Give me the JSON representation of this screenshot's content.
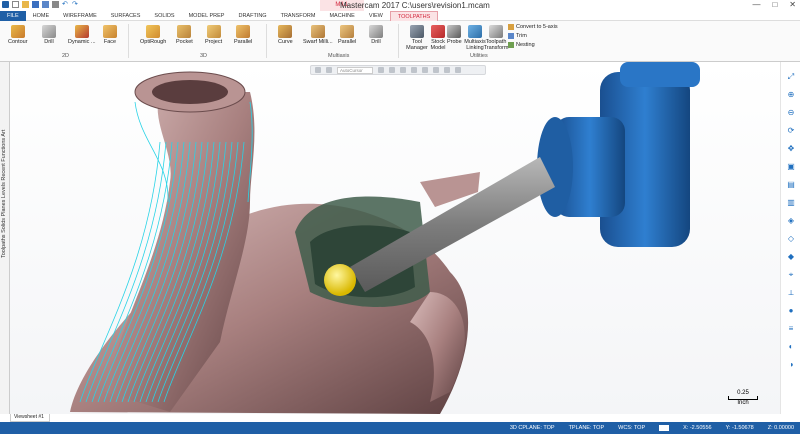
{
  "app": {
    "title": "Mastercam 2017  C:\\users\\revision1.mcam",
    "context_tab": "MILL",
    "window_controls": [
      "—",
      "□",
      "✕"
    ]
  },
  "tabs": [
    "FILE",
    "HOME",
    "WIREFRAME",
    "SURFACES",
    "SOLIDS",
    "MODEL PREP",
    "DRAFTING",
    "TRANSFORM",
    "MACHINE",
    "VIEW",
    "TOOLPATHS"
  ],
  "ribbon": {
    "group_2d": {
      "label": "2D",
      "buttons": [
        "Contour",
        "Drill",
        "Dynamic ...",
        "Face"
      ]
    },
    "group_3d": {
      "label": "3D",
      "buttons": [
        "OptiRough",
        "Pocket",
        "Project",
        "Parallel"
      ]
    },
    "group_multiaxis": {
      "label": "Multiaxis",
      "buttons": [
        "Curve",
        "Swarf Milli...",
        "Parallel",
        "Drill"
      ]
    },
    "group_utilities": {
      "label": "Utilities",
      "buttons": [
        "Tool Manager",
        "Stock Model",
        "Probe",
        "Multiaxis Linking",
        "Toolpath Transform"
      ],
      "small_items": [
        "Convert to 5-axis",
        "Trim",
        "Nesting"
      ]
    }
  },
  "left_panel_label": "Toolpaths  Solids  Planes  Levels  Recent Functions  Art",
  "viewport": {
    "view_toolbar_dropdown": "AutoCursor"
  },
  "scale": {
    "value": "0.25",
    "unit": "Inch"
  },
  "sheet_tab": "Viewsheet #1",
  "status": {
    "cplane": "3D  CPLANE: TOP",
    "tplane": "TPLANE: TOP",
    "wcs": "WCS: TOP",
    "x": "X:  -2.50556",
    "y": "Y:  -1.50678",
    "z": "Z:  0.00000"
  },
  "colors": {
    "file_tab": "#1f5fa6",
    "status_bar": "#1f5fa6",
    "context_tab": "#d2263c",
    "part": "#a8807f",
    "toolpath": "#28d3e6",
    "holder": "#1e66b4",
    "tool_ball": "#f2d000"
  }
}
